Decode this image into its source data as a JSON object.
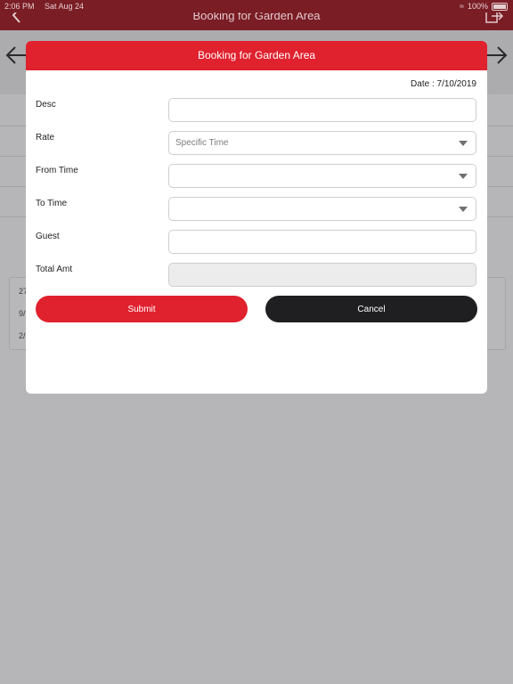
{
  "status_bar": {
    "time": "2:06 PM",
    "date": "Sat Aug 24",
    "battery": "100%"
  },
  "app_header": {
    "title": "Booking for Garden Area"
  },
  "background_table": {
    "rows": [
      "27",
      "9/",
      "2/"
    ]
  },
  "modal": {
    "title": "Booking for Garden Area",
    "date_label": "Date : 7/10/2019",
    "fields": {
      "desc": {
        "label": "Desc",
        "value": ""
      },
      "rate": {
        "label": "Rate",
        "value": "Specific Time"
      },
      "from_time": {
        "label": "From Time",
        "value": ""
      },
      "to_time": {
        "label": "To Time",
        "value": ""
      },
      "guest": {
        "label": "Guest",
        "value": ""
      },
      "total_amt": {
        "label": "Total Amt",
        "value": ""
      }
    },
    "buttons": {
      "submit": "Submit",
      "cancel": "Cancel"
    }
  },
  "colors": {
    "accent": "#e0212e",
    "dark_button": "#1f1f22",
    "overlay": "#b6b5b8"
  }
}
